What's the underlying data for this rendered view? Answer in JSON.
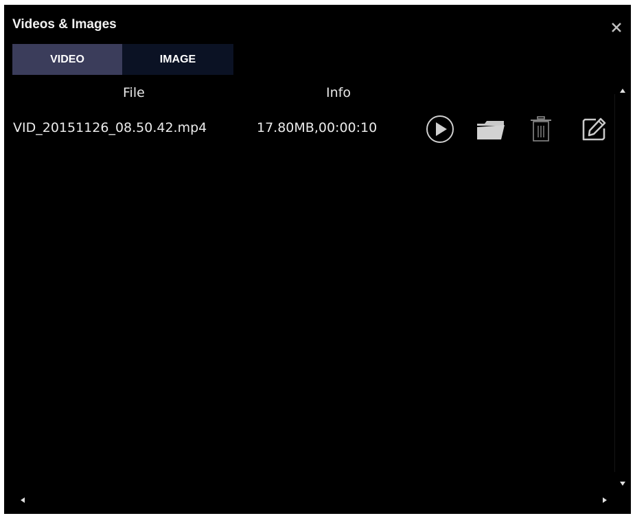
{
  "window": {
    "title": "Videos & Images"
  },
  "tabs": [
    {
      "label": "VIDEO",
      "active": true
    },
    {
      "label": "IMAGE",
      "active": false
    }
  ],
  "columns": {
    "file": "File",
    "info": "Info"
  },
  "rows": [
    {
      "file": "VID_20151126_08.50.42.mp4",
      "info": "17.80MB,00:00:10"
    }
  ],
  "icons": {
    "close": "close-icon",
    "play": "play-icon",
    "folder": "folder-icon",
    "delete": "trash-icon",
    "edit": "edit-icon"
  },
  "colors": {
    "background": "#000000",
    "tab_active": "#3b3d5b",
    "tab_inactive": "#0b1224",
    "text": "#f2f2f2",
    "icon": "#c8c8c8"
  }
}
